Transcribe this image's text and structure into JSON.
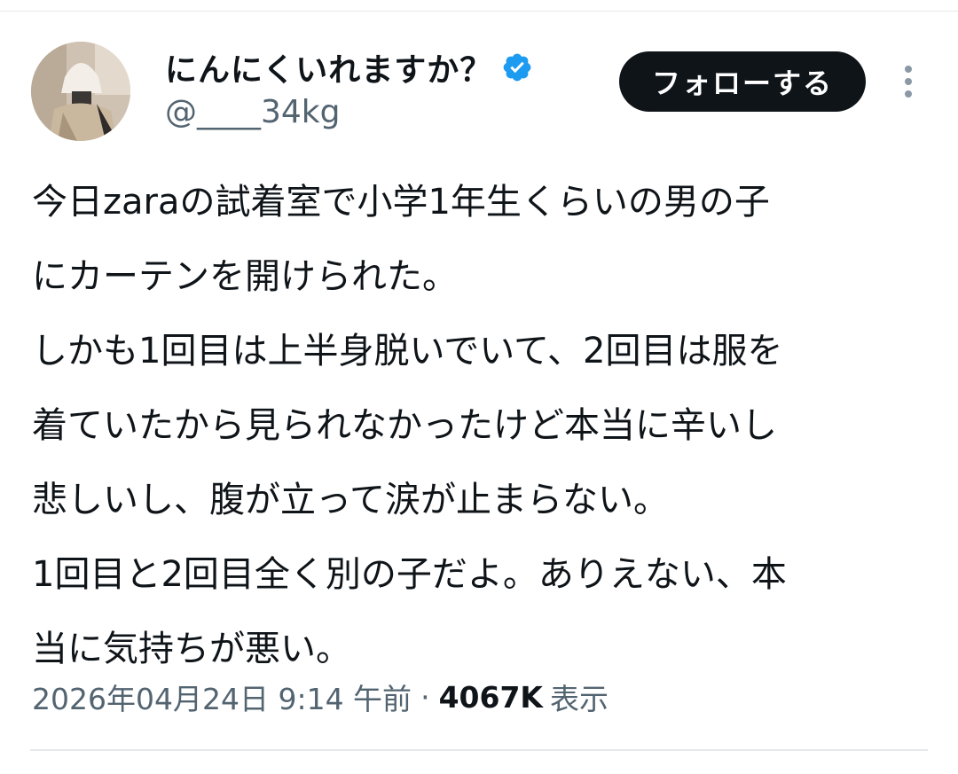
{
  "profile": {
    "display_name": "にんにくいれますか？",
    "handle": "@____34kg",
    "verified_color": "#1d9bf0"
  },
  "actions": {
    "follow_label": "フォローする",
    "more_icon": "more-vertical-icon"
  },
  "tweet": {
    "lines": [
      "今日zaraの試着室で小学1年生くらいの男の子",
      "にカーテンを開けられた。",
      "しかも1回目は上半身脱いでいて、2回目は服を",
      "着ていたから見られなかったけど本当に辛いし",
      "悲しいし、腹が立って涙が止まらない。",
      "1回目と2回目全く別の子だよ。ありえない、本",
      "当に気持ちが悪い。"
    ]
  },
  "meta": {
    "timestamp": "2026年04月24日 9:14 午前",
    "separator": "·",
    "views_count": "4067K",
    "views_label": "表示"
  }
}
